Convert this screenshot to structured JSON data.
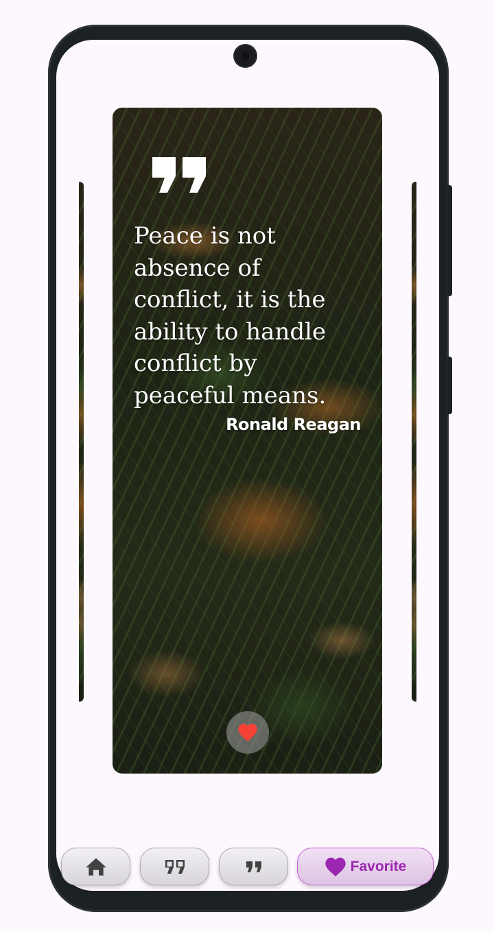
{
  "quote": {
    "text": "Peace is not absence of conflict, it is the ability to handle conflict by peaceful means.",
    "author": "Ronald Reagan"
  },
  "like_button": {
    "icon": "heart-icon",
    "color": "#f44336",
    "liked": true
  },
  "bottom_nav": {
    "items": [
      {
        "id": "home",
        "icon": "home-icon",
        "label": ""
      },
      {
        "id": "quotes",
        "icon": "double-quote-icon",
        "label": ""
      },
      {
        "id": "quote",
        "icon": "quote-icon",
        "label": ""
      },
      {
        "id": "favorite",
        "icon": "heart-icon",
        "label": "Favorite",
        "selected": true
      }
    ],
    "accent_color": "#9c27b0"
  }
}
